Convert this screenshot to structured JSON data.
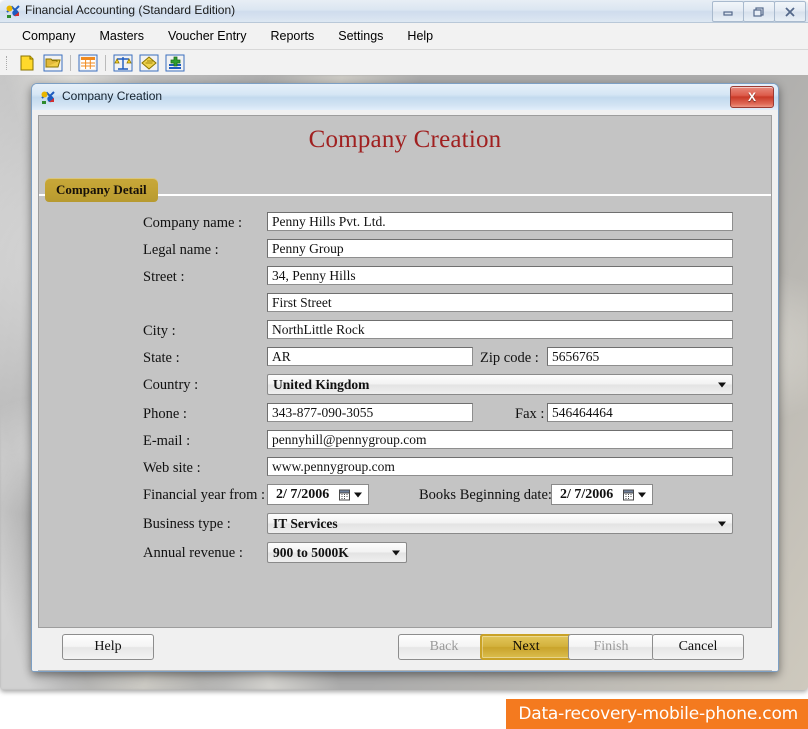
{
  "app": {
    "title": "Financial Accounting (Standard Edition)",
    "icon": "app-logo-icon",
    "window_controls": {
      "minimize": "minimize-icon",
      "restore": "restore-icon",
      "close": "close-icon"
    },
    "menu": [
      {
        "label": "Company"
      },
      {
        "label": "Masters"
      },
      {
        "label": "Voucher Entry"
      },
      {
        "label": "Reports"
      },
      {
        "label": "Settings"
      },
      {
        "label": "Help"
      }
    ],
    "toolbar": [
      {
        "name": "new-company-icon"
      },
      {
        "name": "open-company-icon"
      },
      {
        "name": "ledger-table-icon"
      },
      {
        "name": "trial-balance-icon"
      },
      {
        "name": "voucher-icon"
      },
      {
        "name": "add-entry-icon"
      }
    ]
  },
  "dialog": {
    "titlebar_title": "Company Creation",
    "titlebar_icon": "app-logo-icon",
    "close_label": "X",
    "heading": "Company Creation",
    "tab": {
      "label": "Company Detail"
    },
    "fields": {
      "company_name": {
        "label": "Company name :",
        "value": "Penny Hills Pvt. Ltd."
      },
      "legal_name": {
        "label": "Legal name :",
        "value": "Penny Group"
      },
      "street": {
        "label": "Street :",
        "value": "34, Penny Hills"
      },
      "street2": {
        "label": "",
        "value": "First Street"
      },
      "city": {
        "label": "City :",
        "value": "NorthLittle Rock"
      },
      "state": {
        "label": "State :",
        "value": "AR"
      },
      "zip": {
        "label": "Zip code :",
        "value": "5656765"
      },
      "country": {
        "label": "Country :",
        "value": "United Kingdom"
      },
      "phone": {
        "label": "Phone :",
        "value": "343-877-090-3055"
      },
      "fax": {
        "label": "Fax :",
        "value": "546464464"
      },
      "email": {
        "label": "E-mail :",
        "value": "pennyhill@pennygroup.com"
      },
      "website": {
        "label": "Web site :",
        "value": "www.pennygroup.com"
      },
      "fin_year_from": {
        "label": "Financial year from :",
        "value": "2/  7/2006"
      },
      "books_begin": {
        "label": "Books Beginning date:",
        "value": "2/  7/2006"
      },
      "business_type": {
        "label": "Business type :",
        "value": "IT Services"
      },
      "annual_revenue": {
        "label": "Annual revenue :",
        "value": "900 to 5000K"
      }
    },
    "buttons": {
      "help": "Help",
      "back": "Back",
      "next": "Next",
      "finish": "Finish",
      "cancel": "Cancel"
    }
  },
  "watermark": {
    "text": "Data-recovery-mobile-phone.com"
  },
  "colors": {
    "heading": "#a02020",
    "tab": "#c2a233",
    "primary_button": "#c9a32b",
    "watermark_bg": "#f47a1f",
    "dialog_close": "#c93a28"
  }
}
